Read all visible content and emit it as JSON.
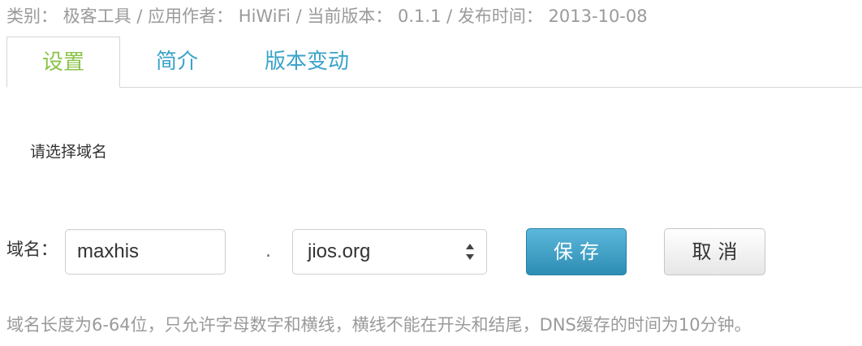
{
  "meta_line": "类别： 极客工具 / 应用作者： HiWiFi / 当前版本： 0.1.1 / 发布时间： 2013-10-08",
  "tabs": [
    {
      "label": "设置",
      "active": true
    },
    {
      "label": "简介",
      "active": false
    },
    {
      "label": "版本变动",
      "active": false
    }
  ],
  "colors": {
    "tab_active": "#8bc34a",
    "tab_inactive": "#3aa3c8",
    "primary_button": "#2e8db4",
    "muted_text": "#9a9a9a"
  },
  "section_title": "请选择域名",
  "form": {
    "domain_label": "域名：",
    "domain_value": "maxhis",
    "separator": ".",
    "suffix_selected": "jios.org",
    "suffix_icon": "up-down-arrows-icon",
    "save_label": "保存",
    "cancel_label": "取消"
  },
  "hint": "域名长度为6-64位，只允许字母数字和横线，横线不能在开头和结尾，DNS缓存的时间为10分钟。"
}
